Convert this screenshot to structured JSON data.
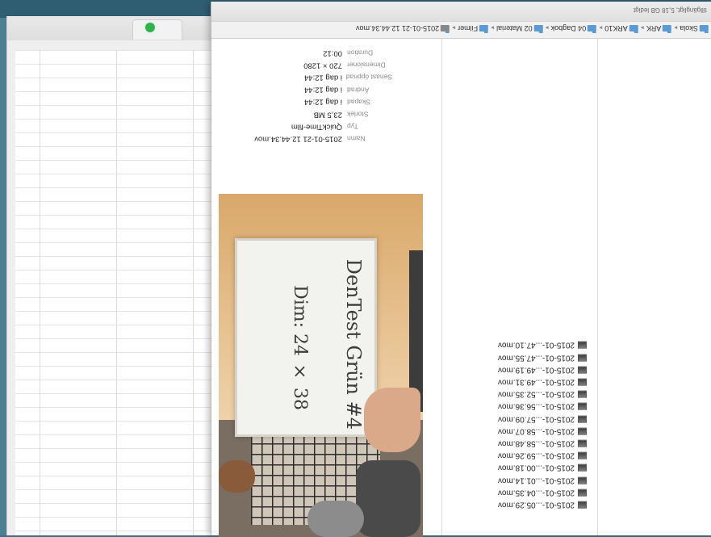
{
  "finder": {
    "available_space": "tillgängligt, 5,18 GB ledigt",
    "path": [
      {
        "label": "Skola"
      },
      {
        "label": "ARK"
      },
      {
        "label": "ARK10"
      },
      {
        "label": "04 Dagbok"
      },
      {
        "label": "02 Material"
      },
      {
        "label": "Filmer"
      },
      {
        "label": "2015-01-21 12.44.34.mov"
      }
    ],
    "files": [
      "2015-01-...05.29.mov",
      "2015-01-...04.35.mov",
      "2015-01-...01.14.mov",
      "2015-01-...00.18.mov",
      "2015-01-...59.26.mov",
      "2015-01-...58.48.mov",
      "2015-01-...58.07.mov",
      "2015-01-...57.09.mov",
      "2015-01-...56.36.mov",
      "2015-01-...52.35.mov",
      "2015-01-...49.31.mov",
      "2015-01-...49.19.mov",
      "2015-01-...47.55.mov",
      "2015-01-...47.10.mov"
    ],
    "info": [
      {
        "key": "Namn",
        "value": "2015-01-21 12.44.34.mov"
      },
      {
        "key": "Typ",
        "value": "QuickTime-film"
      },
      {
        "key": "Storlek",
        "value": "23,5 MB"
      },
      {
        "key": "Skapad",
        "value": "i dag 12:44"
      },
      {
        "key": "Ändrad",
        "value": "i dag 12:44"
      },
      {
        "key": "Senast öppnad",
        "value": "i dag 12:44"
      },
      {
        "key": "Dimensioner",
        "value": "720 × 1280"
      },
      {
        "key": "Duration",
        "value": "00:12"
      }
    ],
    "preview_board": {
      "line1": "DenTest Grün #4",
      "line2": "Dim: 24 × 38"
    }
  },
  "colors": {
    "desktop": "#3f6e86",
    "folder_blue": "#5a9bd5",
    "status_green": "#2fb24a"
  }
}
